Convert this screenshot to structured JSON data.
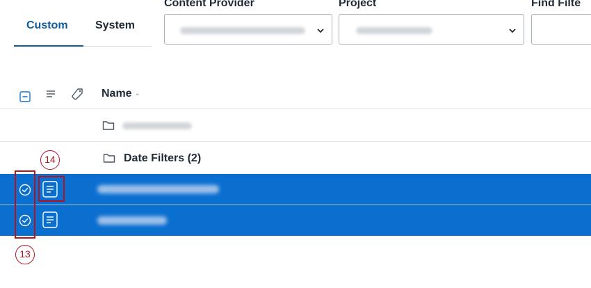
{
  "tabs": [
    {
      "label": "Custom",
      "active": true
    },
    {
      "label": "System",
      "active": false
    }
  ],
  "filters": {
    "content_provider_label": "Content Provider",
    "project_label": "Project",
    "find_filter_label": "Find Filte"
  },
  "table": {
    "name_header": "Name",
    "sort_indicator": "⌄"
  },
  "rows": {
    "date_filters_label": "Date Filters (2)"
  },
  "callouts": {
    "label_13": "13",
    "label_14": "14"
  },
  "colors": {
    "accent": "#0e5a9c",
    "selected_row": "#0b6fd0",
    "callout": "#b3121f"
  },
  "icons": {
    "select_all": "minus-square-icon",
    "list": "list-lines-icon",
    "tag": "tag-icon",
    "folder": "folder-icon",
    "selected": "check-circle-icon",
    "filter_doc": "filter-document-icon",
    "dropdown": "chevron-down-icon"
  }
}
